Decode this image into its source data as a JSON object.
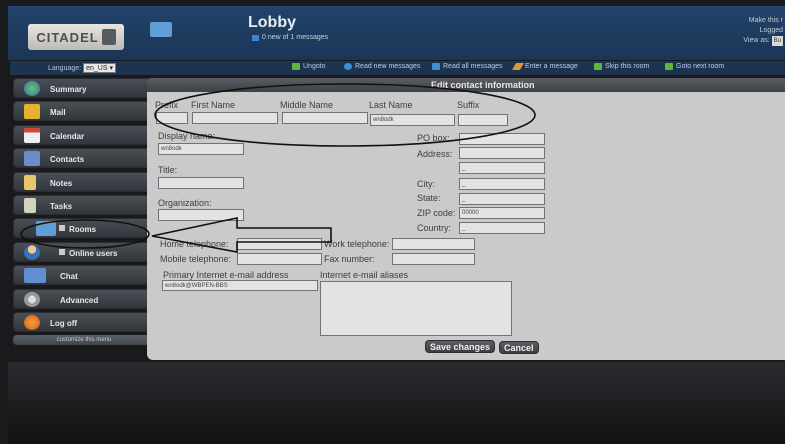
{
  "banner": {
    "logo_text": "CITADEL",
    "room_title": "Lobby",
    "message_count": "0 new of 1 messages",
    "right_lines": [
      "Make this r",
      "Logged"
    ],
    "view_as_label": "View as:",
    "view_as_value": "Bu"
  },
  "toolbar": {
    "language_label": "Language:",
    "language_value": "en_US",
    "items": [
      "Ungoto",
      "Read new messages",
      "Read all messages",
      "Enter a message",
      "Skip this room",
      "Goto next room"
    ]
  },
  "sidebar": {
    "items": [
      "Summary",
      "Mail",
      "Calendar",
      "Contacts",
      "Notes",
      "Tasks",
      "Rooms",
      "Online users",
      "Chat",
      "Advanced",
      "Log off"
    ],
    "customize": "customize this menu"
  },
  "form": {
    "title": "Edit contact information",
    "prefix_label": "Prefix",
    "first_name_label": "First Name",
    "middle_name_label": "Middle Name",
    "last_name_label": "Last Name",
    "suffix_label": "Suffix",
    "last_name_value": "wn8odk",
    "display_name_label": "Display name:",
    "display_name_value": "wn8odk",
    "title_label": "Title:",
    "organization_label": "Organization:",
    "po_box_label": "PO box:",
    "po_box_value": "",
    "address_label": "Address:",
    "address_value2": "_",
    "city_label": "City:",
    "city_value": "_",
    "state_label": "State:",
    "state_value": "_",
    "zip_label": "ZIP code:",
    "zip_value": "00000",
    "country_label": "Country:",
    "country_value": "_",
    "home_tel_label": "Home telephone:",
    "work_tel_label": "Work telephone:",
    "mobile_tel_label": "Mobile telephone:",
    "fax_label": "Fax number:",
    "email_label": "Primary Internet e-mail address",
    "email_value": "wn8odk@WBPEN-BBS",
    "aliases_label": "Internet e-mail aliases",
    "save_label": "Save changes",
    "cancel_label": "Cancel"
  },
  "colors": {
    "banner": "#22436a",
    "panel": "#c9cac9",
    "annotation": "#111111"
  },
  "icons": [
    "globe-icon",
    "mail-icon",
    "calendar-icon",
    "contacts-icon",
    "notes-icon",
    "tasks-icon",
    "folder-icon",
    "users-icon",
    "chat-icon",
    "gear-icon",
    "power-icon"
  ]
}
